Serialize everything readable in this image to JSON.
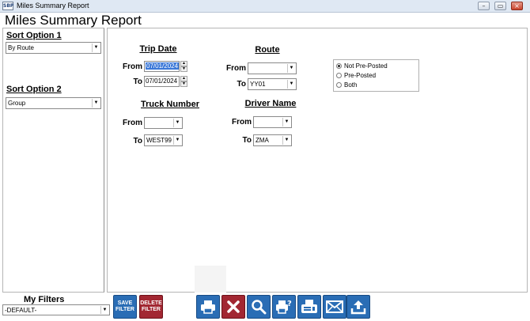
{
  "window": {
    "app_icon_text": "SBP",
    "title": "Miles Summary Report",
    "controls": [
      "–",
      "▭",
      "×"
    ]
  },
  "report_title": "Miles Summary Report",
  "sort_option_1": {
    "label": "Sort Option 1",
    "value": "By Route"
  },
  "sort_option_2": {
    "label": "Sort Option 2",
    "value": "Group"
  },
  "trip_date": {
    "label": "Trip Date",
    "from_label": "From",
    "from_value": "07/01/2024",
    "to_label": "To",
    "to_value": "07/01/2024"
  },
  "route": {
    "label": "Route",
    "from_label": "From",
    "from_value": "",
    "to_label": "To",
    "to_value": "YY01"
  },
  "truck_number": {
    "label": "Truck Number",
    "from_label": "From",
    "from_value": "",
    "to_label": "To",
    "to_value": "WEST99"
  },
  "driver_name": {
    "label": "Driver Name",
    "from_label": "From",
    "from_value": "",
    "to_label": "To",
    "to_value": "ZMA"
  },
  "posting_options": [
    {
      "label": "Not Pre-Posted",
      "selected": true
    },
    {
      "label": "Pre-Posted",
      "selected": false
    },
    {
      "label": "Both",
      "selected": false
    }
  ],
  "my_filters": {
    "label": "My Filters",
    "value": "-DEFAULT-"
  },
  "toolbar": {
    "save_filter_line1": "SAVE",
    "save_filter_line2": "FILTER",
    "delete_filter_line1": "DELETE",
    "delete_filter_line2": "FILTER"
  },
  "icons": [
    "print-icon",
    "cancel-icon",
    "preview-icon",
    "print-setup-icon",
    "fax-icon",
    "email-icon",
    "export-icon"
  ],
  "colors": {
    "blue_button": "#2a6db5",
    "red_button": "#a22732",
    "date_highlight": "#3b78d8"
  }
}
